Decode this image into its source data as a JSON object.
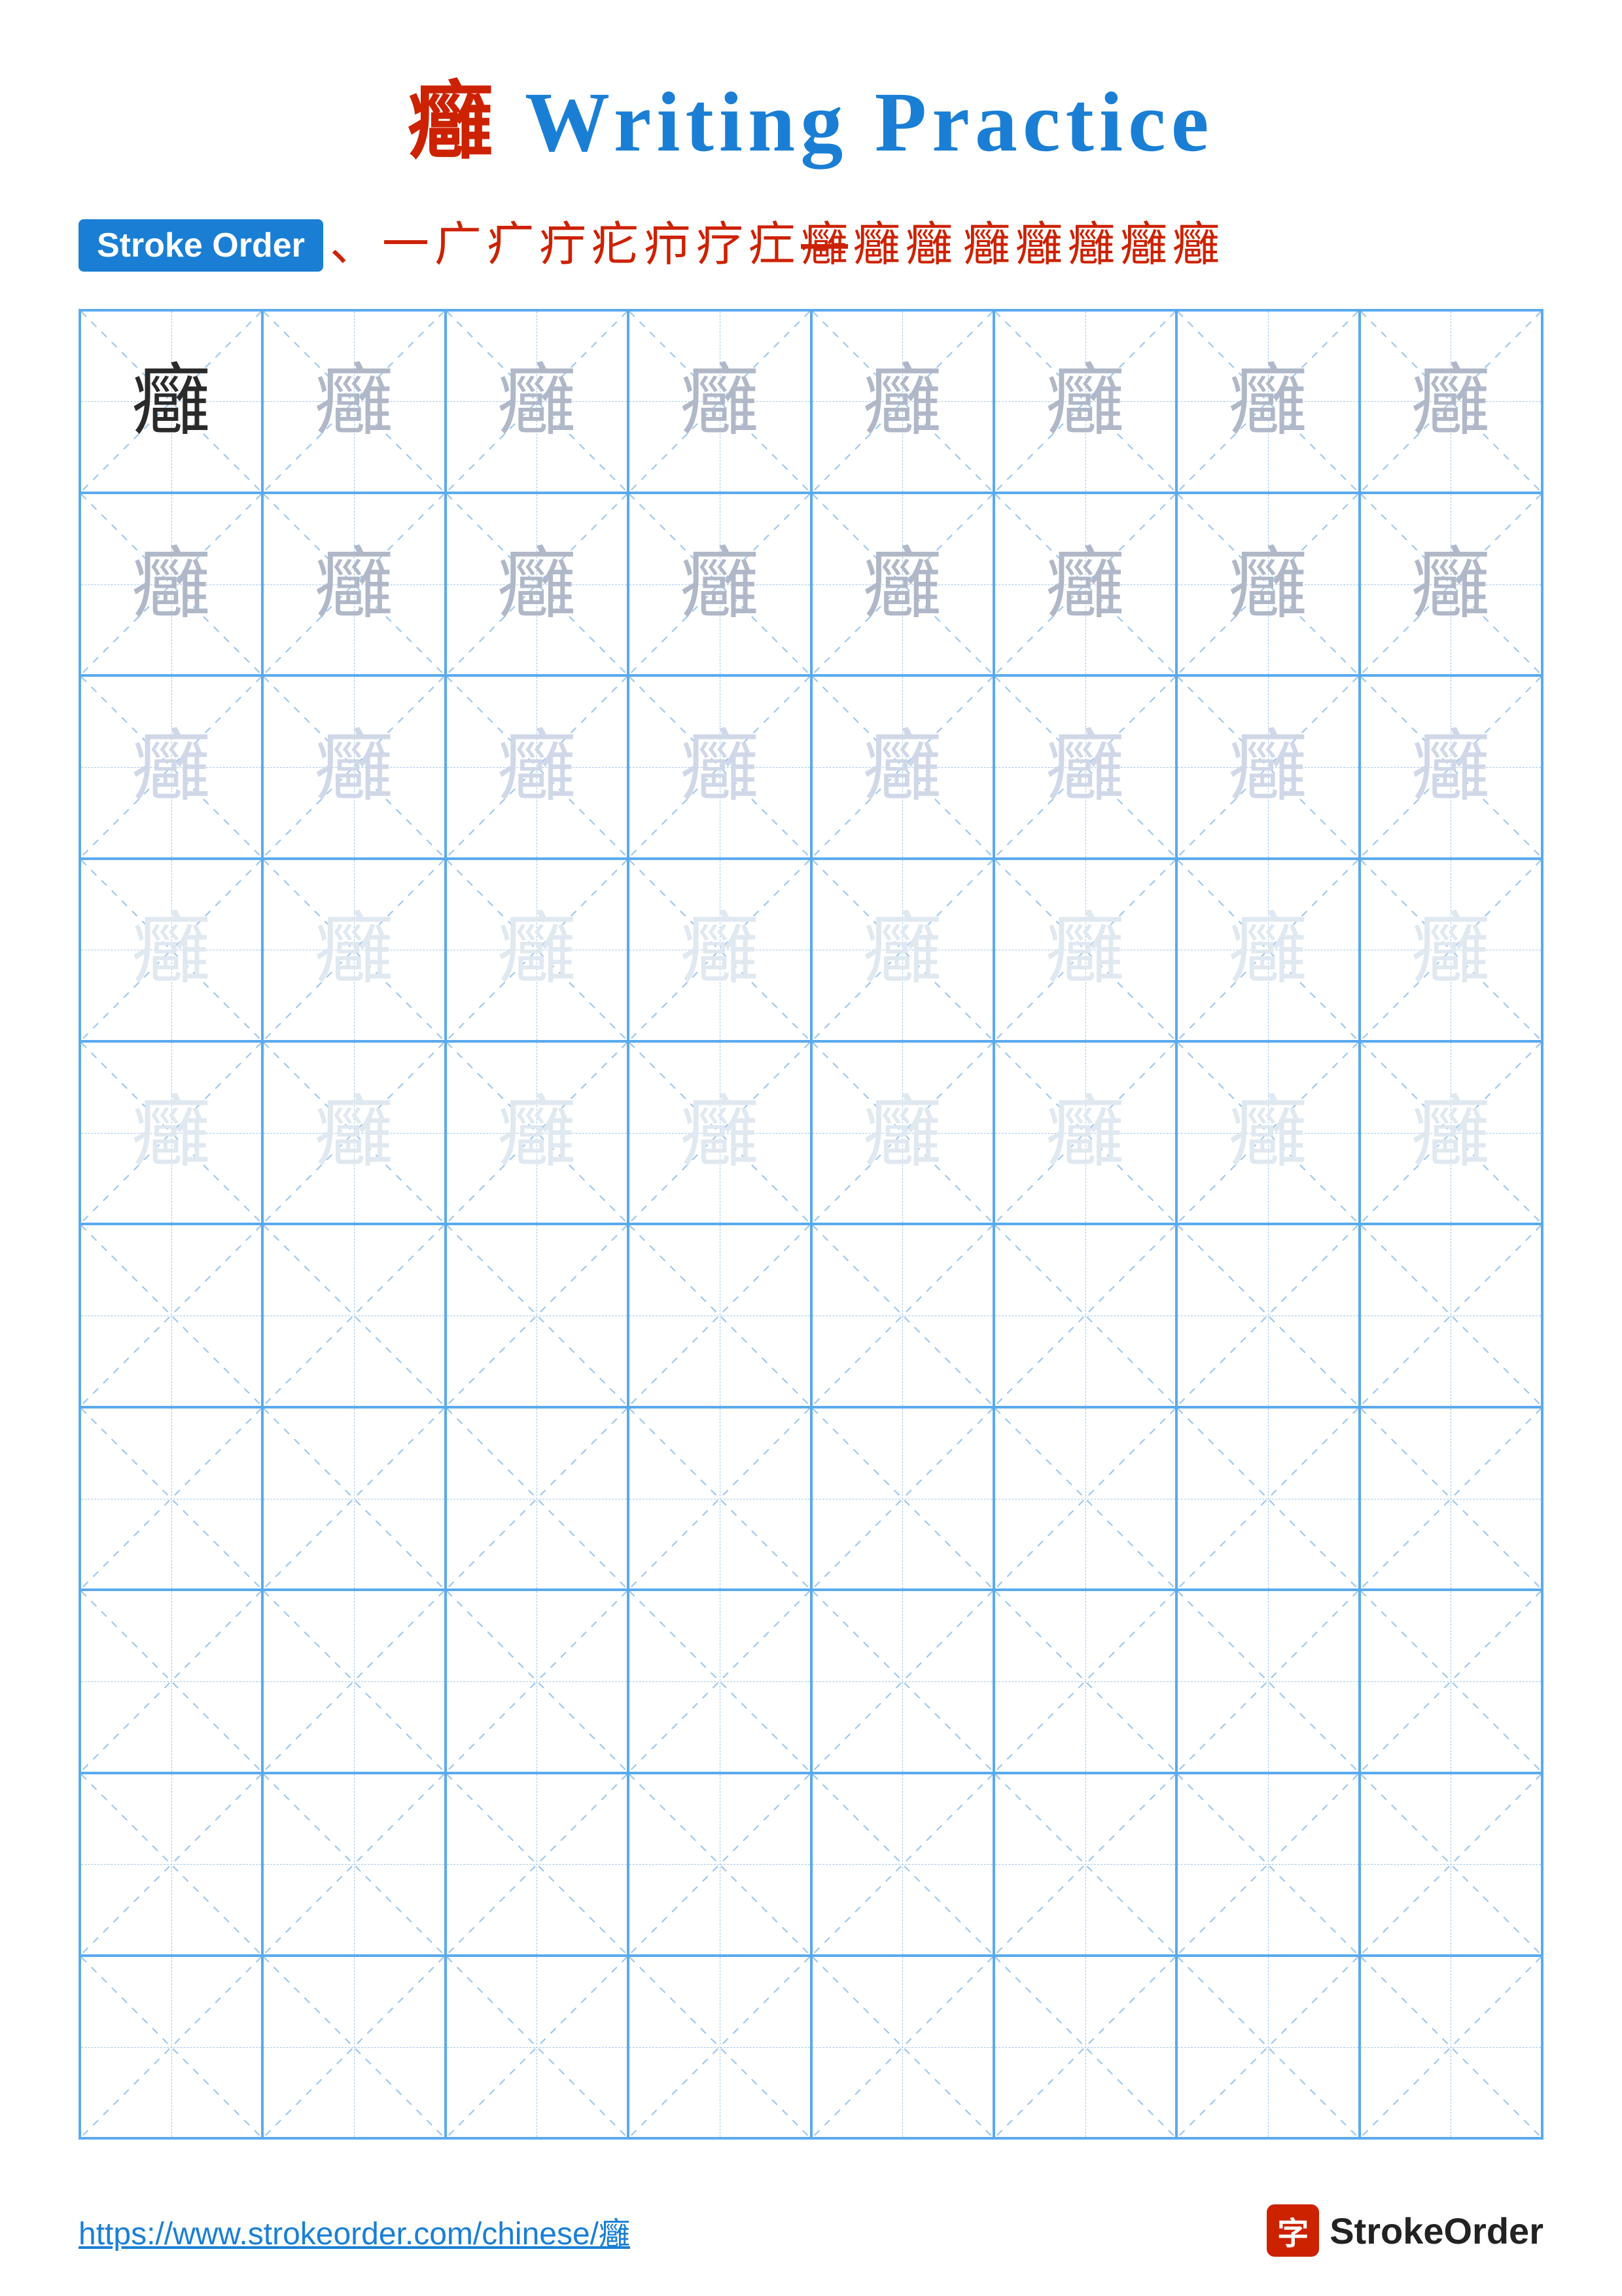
{
  "title": {
    "char": "癰",
    "suffix": " Writing Practice"
  },
  "stroke_order": {
    "badge_label": "Stroke Order",
    "strokes": [
      "﹑",
      "一",
      "广",
      "疒",
      "疔",
      "疕",
      "疖",
      "疗",
      "疘",
      "疙",
      "疚",
      "疛",
      "疜",
      "癰",
      "癰",
      "癰"
    ]
  },
  "grid": {
    "rows": 10,
    "cols": 8,
    "char": "癰",
    "filled_rows": 5,
    "opacities": [
      "dark",
      "medium",
      "light",
      "very-light",
      "very-light"
    ]
  },
  "footer": {
    "url": "https://www.strokeorder.com/chinese/癰",
    "brand": "StrokeOrder"
  }
}
